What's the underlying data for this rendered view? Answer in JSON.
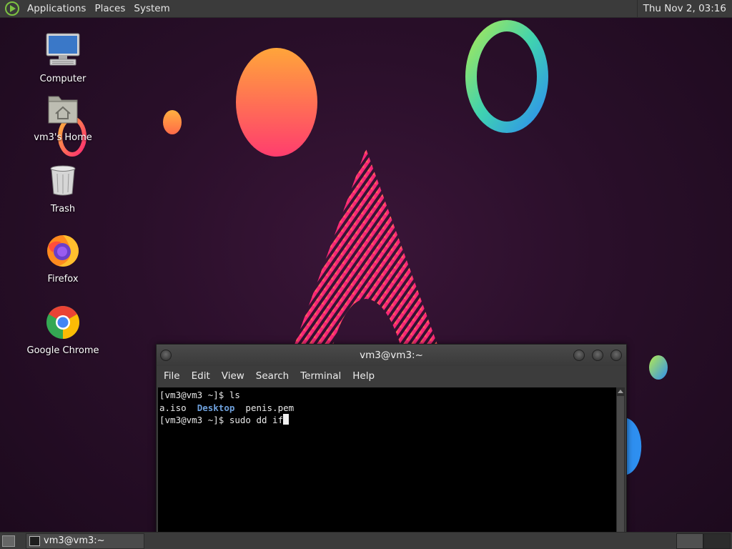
{
  "top_panel": {
    "menus": [
      "Applications",
      "Places",
      "System"
    ],
    "clock": "Thu Nov  2, 03:16"
  },
  "desktop": {
    "icons": [
      {
        "label": "Computer",
        "icon": "computer-icon"
      },
      {
        "label": "vm3's Home",
        "icon": "home-folder-icon"
      },
      {
        "label": "Trash",
        "icon": "trash-icon"
      },
      {
        "label": "Firefox",
        "icon": "firefox-icon"
      },
      {
        "label": "Google Chrome",
        "icon": "chrome-icon"
      }
    ]
  },
  "terminal": {
    "title": "vm3@vm3:~",
    "menu": [
      "File",
      "Edit",
      "View",
      "Search",
      "Terminal",
      "Help"
    ],
    "lines": {
      "l1_prompt": "[vm3@vm3 ~]$ ",
      "l1_cmd": "ls",
      "l2_a": "a.iso  ",
      "l2_dir": "Desktop",
      "l2_b": "  penis.pem",
      "l3_prompt": "[vm3@vm3 ~]$ ",
      "l3_cmd": "sudo dd if"
    },
    "colors": {
      "directory": "#6ea0dc",
      "background": "#000000"
    }
  },
  "taskbar": {
    "task_label": "vm3@vm3:~"
  }
}
